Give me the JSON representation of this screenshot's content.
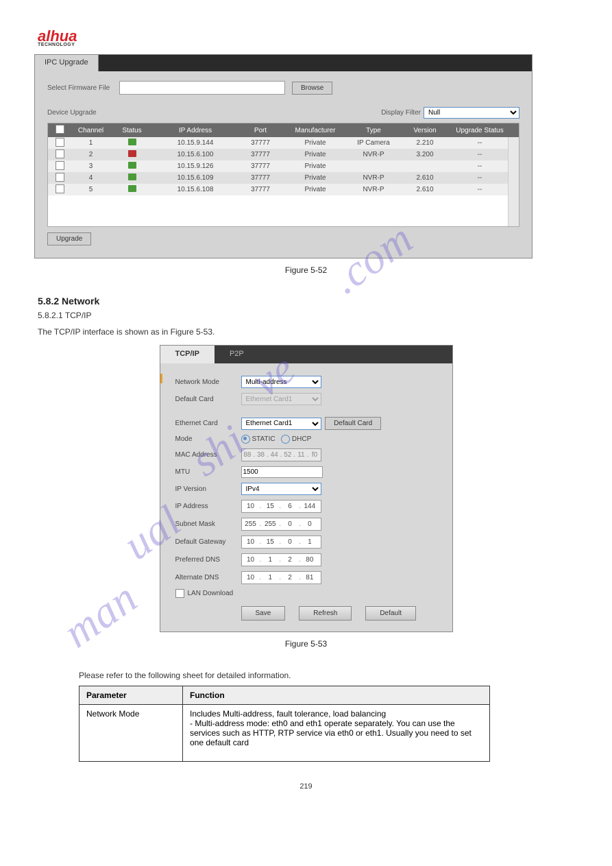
{
  "logo": {
    "brand": "alhua",
    "sub": "TECHNOLOGY"
  },
  "panel1": {
    "tab": "IPC Upgrade",
    "fileLabel": "Select Firmware File",
    "browse": "Browse",
    "deviceLabel": "Device Upgrade",
    "filterLabel": "Display Filter",
    "filterValue": "Null",
    "headers": {
      "channel": "Channel",
      "status": "Status",
      "ip": "IP Address",
      "port": "Port",
      "mfr": "Manufacturer",
      "type": "Type",
      "version": "Version",
      "upgrade": "Upgrade Status"
    },
    "rows": [
      {
        "ch": "1",
        "ip": "10.15.9.144",
        "port": "37777",
        "mfr": "Private",
        "type": "IP Camera",
        "ver": "2.210",
        "us": "--",
        "red": false
      },
      {
        "ch": "2",
        "ip": "10.15.6.100",
        "port": "37777",
        "mfr": "Private",
        "type": "NVR-P",
        "ver": "3.200",
        "us": "--",
        "red": true
      },
      {
        "ch": "3",
        "ip": "10.15.9.126",
        "port": "37777",
        "mfr": "Private",
        "type": "",
        "ver": "",
        "us": "--",
        "red": false
      },
      {
        "ch": "4",
        "ip": "10.15.6.109",
        "port": "37777",
        "mfr": "Private",
        "type": "NVR-P",
        "ver": "2.610",
        "us": "--",
        "red": false
      },
      {
        "ch": "5",
        "ip": "10.15.6.108",
        "port": "37777",
        "mfr": "Private",
        "type": "NVR-P",
        "ver": "2.610",
        "us": "--",
        "red": false
      }
    ],
    "upgradeBtn": "Upgrade"
  },
  "fig1": "Figure 5-52",
  "sec": {
    "num": "5.8.2 Network",
    "body1": "5.8.2.1 TCP/IP",
    "body2": "The TCP/IP interface is shown as in Figure 5-53."
  },
  "panel2": {
    "tab1": "TCP/IP",
    "tab2": "P2P",
    "labels": {
      "netmode": "Network Mode",
      "defcard": "Default Card",
      "ethcard": "Ethernet Card",
      "mode": "Mode",
      "mac": "MAC Address",
      "mtu": "MTU",
      "ipver": "IP Version",
      "ipaddr": "IP Address",
      "subnet": "Subnet Mask",
      "gateway": "Default Gateway",
      "pdns": "Preferred DNS",
      "adns": "Alternate DNS",
      "lan": "LAN Download"
    },
    "values": {
      "netmode": "Multi-address",
      "defcard": "Ethernet Card1",
      "ethcard": "Ethernet Card1",
      "defcardBtn": "Default Card",
      "static": "STATIC",
      "dhcp": "DHCP",
      "mac": [
        "88",
        "38",
        "44",
        "52",
        "11",
        "f0"
      ],
      "mtu": "1500",
      "ipver": "IPv4",
      "ipaddr": [
        "10",
        "15",
        "6",
        "144"
      ],
      "subnet": [
        "255",
        "255",
        "0",
        "0"
      ],
      "gateway": [
        "10",
        "15",
        "0",
        "1"
      ],
      "pdns": [
        "10",
        "1",
        "2",
        "80"
      ],
      "adns": [
        "10",
        "1",
        "2",
        "81"
      ]
    },
    "buttons": {
      "save": "Save",
      "refresh": "Refresh",
      "default": "Default"
    }
  },
  "fig2": "Figure 5-53",
  "refer": "Please refer to the following sheet for detailed information.",
  "table": {
    "h1": "Parameter",
    "h2": "Function",
    "r1p": "Network Mode",
    "r1f": "Includes Multi-address, fault tolerance, load balancing\n- Multi-address mode: eth0 and eth1 operate separately. You can use the services such as HTTP, RTP service via eth0 or eth1. Usually you need to set one default card"
  },
  "footer": "219"
}
